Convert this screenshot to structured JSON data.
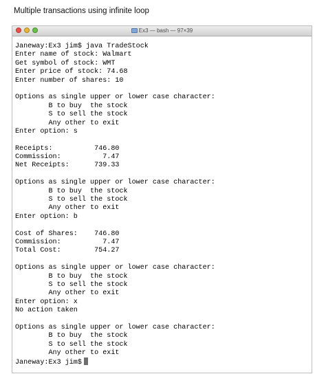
{
  "caption": "Multiple transactions using infinite loop",
  "window": {
    "title": "Ex3 — bash — 97×39"
  },
  "terminal": {
    "lines": [
      "Janeway:Ex3 jim$ java TradeStock",
      "Enter name of stock: Walmart",
      "Get symbol of stock: WMT",
      "Enter price of stock: 74.68",
      "Enter number of shares: 10",
      "",
      "Options as single upper or lower case character:",
      "        B to buy  the stock",
      "        S to sell the stock",
      "        Any other to exit",
      "Enter option: s",
      "",
      "Receipts:          746.80",
      "Commission:          7.47",
      "Net Receipts:      739.33",
      "",
      "Options as single upper or lower case character:",
      "        B to buy  the stock",
      "        S to sell the stock",
      "        Any other to exit",
      "Enter option: b",
      "",
      "Cost of Shares:    746.80",
      "Commission:          7.47",
      "Total Cost:        754.27",
      "",
      "Options as single upper or lower case character:",
      "        B to buy  the stock",
      "        S to sell the stock",
      "        Any other to exit",
      "Enter option: x",
      "No action taken",
      "",
      "Options as single upper or lower case character:",
      "        B to buy  the stock",
      "        S to sell the stock",
      "        Any other to exit",
      "Janeway:Ex3 jim$"
    ]
  }
}
